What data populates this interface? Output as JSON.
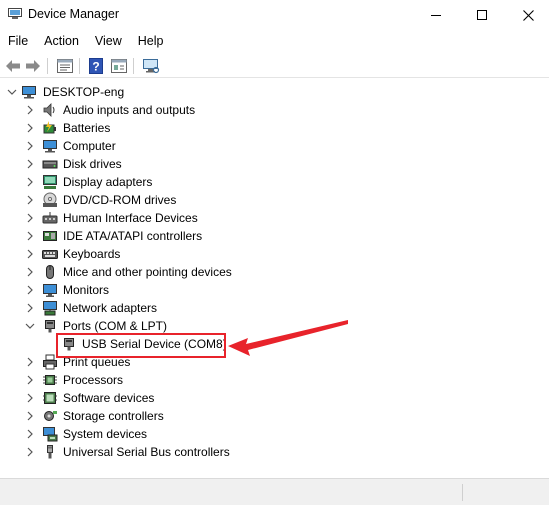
{
  "window": {
    "title": "Device Manager",
    "controls": [
      "minimize-icon",
      "maximize-icon",
      "close-icon"
    ]
  },
  "menu": {
    "items": [
      "File",
      "Action",
      "View",
      "Help"
    ]
  },
  "toolbar": {
    "buttons": [
      "back-arrow-icon",
      "forward-arrow-icon",
      "properties-icon",
      "help-icon",
      "update-driver-icon",
      "scan-hardware-icon"
    ]
  },
  "tree": {
    "root": {
      "label": "DESKTOP-eng",
      "expanded": true
    },
    "categories": [
      {
        "label": "Audio inputs and outputs",
        "icon": "speaker-icon",
        "expanded": false
      },
      {
        "label": "Batteries",
        "icon": "battery-icon",
        "expanded": false
      },
      {
        "label": "Computer",
        "icon": "computer-icon",
        "expanded": false
      },
      {
        "label": "Disk drives",
        "icon": "disk-drive-icon",
        "expanded": false
      },
      {
        "label": "Display adapters",
        "icon": "display-adapter-icon",
        "expanded": false
      },
      {
        "label": "DVD/CD-ROM drives",
        "icon": "dvd-drive-icon",
        "expanded": false
      },
      {
        "label": "Human Interface Devices",
        "icon": "hid-icon",
        "expanded": false
      },
      {
        "label": "IDE ATA/ATAPI controllers",
        "icon": "ide-controller-icon",
        "expanded": false
      },
      {
        "label": "Keyboards",
        "icon": "keyboard-icon",
        "expanded": false
      },
      {
        "label": "Mice and other pointing devices",
        "icon": "mouse-icon",
        "expanded": false
      },
      {
        "label": "Monitors",
        "icon": "monitor-icon",
        "expanded": false
      },
      {
        "label": "Network adapters",
        "icon": "network-adapter-icon",
        "expanded": false
      },
      {
        "label": "Ports (COM & LPT)",
        "icon": "port-icon",
        "expanded": true
      },
      {
        "label": "USB Serial Device (COM8)",
        "icon": "serial-port-icon",
        "child": true
      },
      {
        "label": "Print queues",
        "icon": "printer-icon",
        "expanded": false
      },
      {
        "label": "Processors",
        "icon": "processor-icon",
        "expanded": false
      },
      {
        "label": "Software devices",
        "icon": "software-device-icon",
        "expanded": false
      },
      {
        "label": "Storage controllers",
        "icon": "storage-controller-icon",
        "expanded": false
      },
      {
        "label": "System devices",
        "icon": "system-device-icon",
        "expanded": false
      },
      {
        "label": "Universal Serial Bus controllers",
        "icon": "usb-controller-icon",
        "expanded": false
      }
    ]
  },
  "annotation": {
    "highlight_color": "#e8232b"
  }
}
